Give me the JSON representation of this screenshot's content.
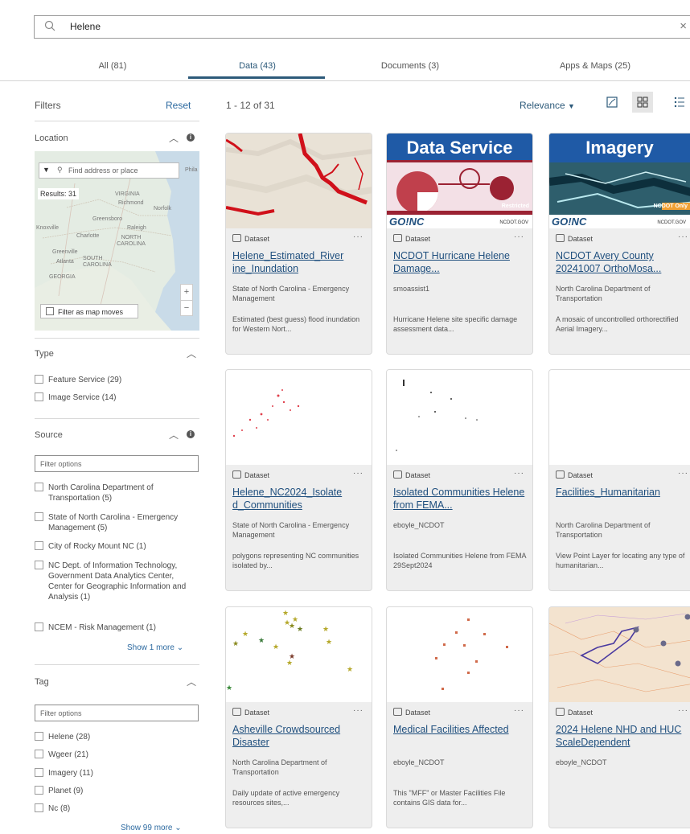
{
  "search": {
    "value": "Helene"
  },
  "tabs": [
    {
      "label": "All (81)"
    },
    {
      "label": "Data (43)"
    },
    {
      "label": "Documents (3)"
    },
    {
      "label": "Apps & Maps (25)"
    }
  ],
  "filters": {
    "title": "Filters",
    "reset": "Reset",
    "location": {
      "header": "Location",
      "search_placeholder": "Find address or place",
      "results": "Results: 31",
      "filter_as_map_moves": "Filter as map moves",
      "place_labels": [
        "Phila",
        "VIRGINIA",
        "Richmond",
        "Norfolk",
        "Knoxville",
        "Greensboro",
        "Raleigh",
        "Charlotte",
        "NORTH CAROLINA",
        "Greenville",
        "Atlanta",
        "SOUTH CAROLINA",
        "GEORGIA"
      ]
    },
    "type": {
      "header": "Type",
      "options": [
        "Feature Service (29)",
        "Image Service (14)"
      ]
    },
    "source": {
      "header": "Source",
      "placeholder": "Filter options",
      "options": [
        "North Carolina Department of Transportation (5)",
        "State of North Carolina - Emergency Management (5)",
        "City of Rocky Mount NC (1)",
        "NC Dept. of Information Technology, Government Data Analytics Center, Center for Geographic Information and Analysis (1)",
        "NCEM - Risk Management (1)"
      ],
      "show_more": "Show 1 more"
    },
    "tag": {
      "header": "Tag",
      "placeholder": "Filter options",
      "options": [
        "Helene (28)",
        "Wgeer (21)",
        "Imagery (11)",
        "Planet (9)",
        "Nc (8)"
      ],
      "show_more": "Show 99 more"
    }
  },
  "results": {
    "count": "1 - 12 of 31",
    "sort": "Relevance",
    "cards": [
      {
        "type": "Dataset",
        "title": "Helene_Estimated_River ine_Inundation",
        "owner": "State of North Carolina - Emergency Management",
        "snippet": "Estimated (best guess) flood inundation for Western Nort..."
      },
      {
        "type": "Dataset",
        "title": "NCDOT Hurricane Helene Damage...",
        "owner": "smoassist1",
        "snippet": "Hurricane Helene site specific damage assessment data...",
        "banner": "Data Service",
        "badge": "Restricted",
        "brand": "GO!NC",
        "brand_site": "NCDOT.GOV"
      },
      {
        "type": "Dataset",
        "title": "NCDOT Avery County 20241007 OrthoMosa...",
        "owner": "North Carolina Department of Transportation",
        "snippet": "A mosaic of uncontrolled orthorectified Aerial Imagery...",
        "banner": "Imagery",
        "badge": "NCDOT Only",
        "brand": "GO!NC",
        "brand_site": "NCDOT.GOV"
      },
      {
        "type": "Dataset",
        "title": "Helene_NC2024_Isolate d_Communities",
        "owner": "State of North Carolina - Emergency Management",
        "snippet": "polygons representing NC communities isolated by..."
      },
      {
        "type": "Dataset",
        "title": "Isolated Communities Helene from FEMA...",
        "owner": "eboyle_NCDOT",
        "snippet": "Isolated Communities Helene from FEMA 29Sept2024"
      },
      {
        "type": "Dataset",
        "title": "Facilities_Humanitarian",
        "owner": "North Carolina Department of Transportation",
        "snippet": "View Point Layer for locating any type of humanitarian..."
      },
      {
        "type": "Dataset",
        "title": "Asheville Crowdsourced Disaster",
        "owner": "North Carolina Department of Transportation",
        "snippet": "Daily update of active emergency resources sites,..."
      },
      {
        "type": "Dataset",
        "title": "Medical Facilities Affected",
        "owner": "eboyle_NCDOT",
        "snippet": "This \"MFF\" or Master Facilities File contains GIS data for..."
      },
      {
        "type": "Dataset",
        "title": "2024 Helene NHD and HUC ScaleDependent",
        "owner": "eboyle_NCDOT",
        "snippet": ""
      }
    ]
  },
  "colors": {
    "accent": "#2d5a7a",
    "link": "#1f4f7e",
    "banner": "#1f5aa6",
    "flood_red": "#d0101a"
  }
}
